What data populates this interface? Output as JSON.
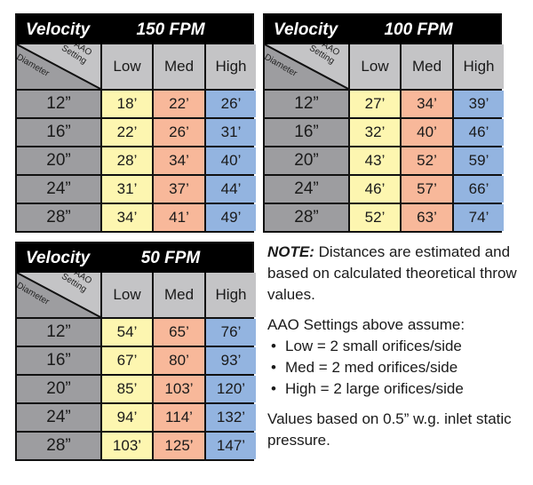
{
  "colors": {
    "low": "#fdf6b0",
    "med": "#f8b89a",
    "high": "#93b4e0",
    "diameter": "#9d9da0",
    "header_bg": "#000000",
    "column_header": "#c4c4c6"
  },
  "tables": [
    {
      "velocity_label": "Velocity",
      "fpm": "150 FPM",
      "corner_top": "AAO Setting",
      "corner_bottom": "Diameter",
      "columns": [
        "Low",
        "Med",
        "High"
      ],
      "rows": [
        {
          "diameter": "12”",
          "low": "18’",
          "med": "22’",
          "high": "26’"
        },
        {
          "diameter": "16”",
          "low": "22’",
          "med": "26’",
          "high": "31’"
        },
        {
          "diameter": "20”",
          "low": "28’",
          "med": "34’",
          "high": "40’"
        },
        {
          "diameter": "24”",
          "low": "31’",
          "med": "37’",
          "high": "44’"
        },
        {
          "diameter": "28”",
          "low": "34’",
          "med": "41’",
          "high": "49’"
        }
      ]
    },
    {
      "velocity_label": "Velocity",
      "fpm": "100 FPM",
      "corner_top": "AAO Setting",
      "corner_bottom": "Diameter",
      "columns": [
        "Low",
        "Med",
        "High"
      ],
      "rows": [
        {
          "diameter": "12”",
          "low": "27’",
          "med": "34’",
          "high": "39’"
        },
        {
          "diameter": "16”",
          "low": "32’",
          "med": "40’",
          "high": "46’"
        },
        {
          "diameter": "20”",
          "low": "43’",
          "med": "52’",
          "high": "59’"
        },
        {
          "diameter": "24”",
          "low": "46’",
          "med": "57’",
          "high": "66’"
        },
        {
          "diameter": "28”",
          "low": "52’",
          "med": "63’",
          "high": "74’"
        }
      ]
    },
    {
      "velocity_label": "Velocity",
      "fpm": "50 FPM",
      "corner_top": "AAO Setting",
      "corner_bottom": "Diameter",
      "columns": [
        "Low",
        "Med",
        "High"
      ],
      "rows": [
        {
          "diameter": "12”",
          "low": "54’",
          "med": "65’",
          "high": "76’"
        },
        {
          "diameter": "16”",
          "low": "67’",
          "med": "80’",
          "high": "93’"
        },
        {
          "diameter": "20”",
          "low": "85’",
          "med": "103’",
          "high": "120’"
        },
        {
          "diameter": "24”",
          "low": "94’",
          "med": "114’",
          "high": "132’"
        },
        {
          "diameter": "28”",
          "low": "103’",
          "med": "125’",
          "high": "147’"
        }
      ]
    }
  ],
  "notes": {
    "note_label": "NOTE:",
    "note_text": " Distances are estimated and based on calculated theoretical throw values.",
    "settings_intro": "AAO Settings above assume:",
    "bullet": "•",
    "settings": [
      "Low = 2 small orifices/side",
      "Med = 2 med orifices/side",
      "High = 2 large orifices/side"
    ],
    "pressure_note": "Values based on 0.5” w.g. inlet static pressure."
  }
}
